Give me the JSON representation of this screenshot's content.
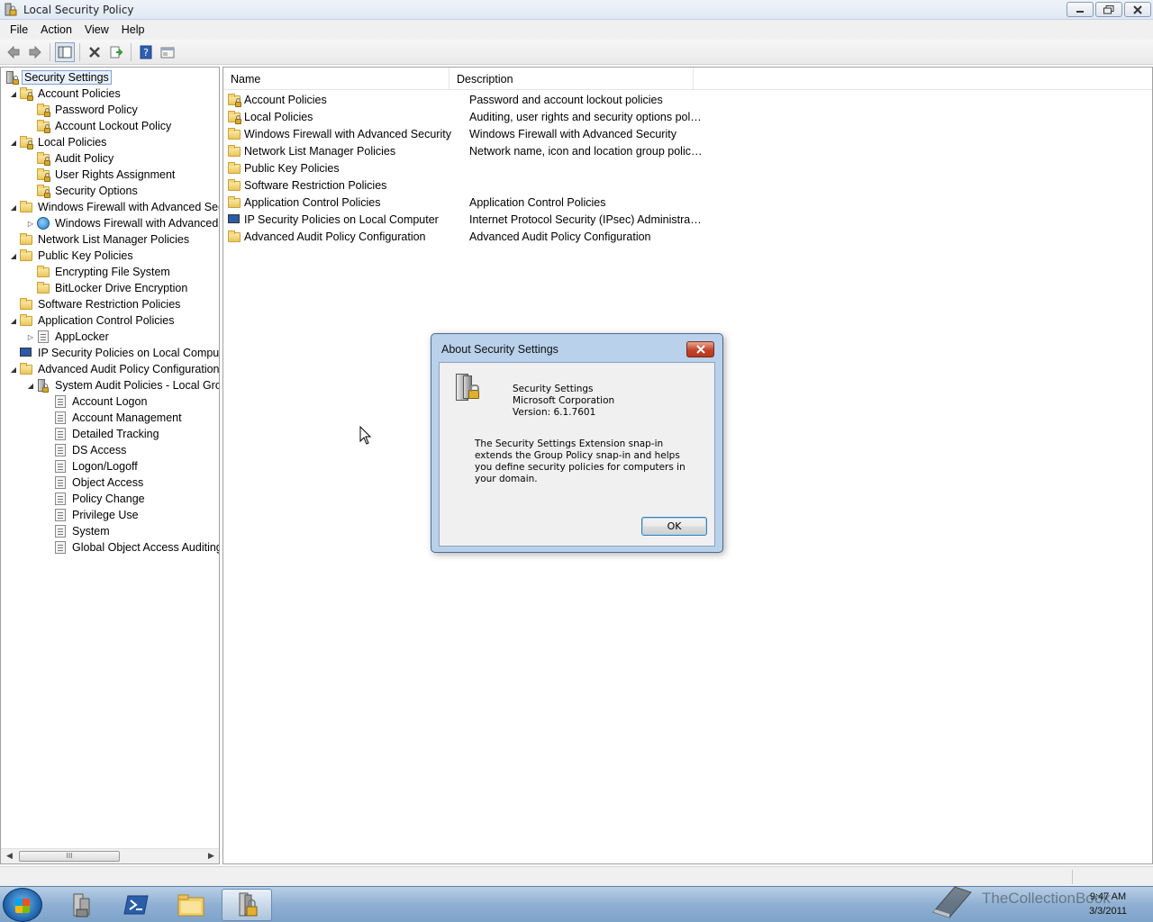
{
  "window": {
    "title": "Local Security Policy",
    "minimize_label": "▭",
    "restore_label": "❐",
    "close_label": "✕"
  },
  "menu": [
    "File",
    "Action",
    "View",
    "Help"
  ],
  "toolbar": {
    "buttons": [
      "back-icon",
      "forward-icon",
      "show-hide-tree-icon",
      "delete-icon",
      "export-list-icon",
      "help-icon",
      "properties-icon"
    ]
  },
  "tree": {
    "root": "Security Settings",
    "items": [
      {
        "label": "Account Policies",
        "icon": "folder-lock",
        "expanded": true
      },
      {
        "label": "Password Policy",
        "icon": "folder-lock"
      },
      {
        "label": "Account Lockout Policy",
        "icon": "folder-lock"
      },
      {
        "label": "Local Policies",
        "icon": "folder-lock",
        "expanded": true
      },
      {
        "label": "Audit Policy",
        "icon": "folder-lock"
      },
      {
        "label": "User Rights Assignment",
        "icon": "folder-lock"
      },
      {
        "label": "Security Options",
        "icon": "folder-lock"
      },
      {
        "label": "Windows Firewall with Advanced Secu",
        "icon": "folder",
        "expanded": true
      },
      {
        "label": "Windows Firewall with Advanced",
        "icon": "globe",
        "collapsed": true
      },
      {
        "label": "Network List Manager Policies",
        "icon": "folder"
      },
      {
        "label": "Public Key Policies",
        "icon": "folder",
        "expanded": true
      },
      {
        "label": "Encrypting File System",
        "icon": "folder"
      },
      {
        "label": "BitLocker Drive Encryption",
        "icon": "folder"
      },
      {
        "label": "Software Restriction Policies",
        "icon": "folder"
      },
      {
        "label": "Application Control Policies",
        "icon": "folder",
        "expanded": true
      },
      {
        "label": "AppLocker",
        "icon": "doc",
        "collapsed": true
      },
      {
        "label": "IP Security Policies on Local Compute",
        "icon": "monitor"
      },
      {
        "label": "Advanced Audit Policy Configuration",
        "icon": "folder",
        "expanded": true
      },
      {
        "label": "System Audit Policies - Local Grou",
        "icon": "server",
        "expanded": true
      },
      {
        "label": "Account Logon",
        "icon": "doc"
      },
      {
        "label": "Account Management",
        "icon": "doc"
      },
      {
        "label": "Detailed Tracking",
        "icon": "doc"
      },
      {
        "label": "DS Access",
        "icon": "doc"
      },
      {
        "label": "Logon/Logoff",
        "icon": "doc"
      },
      {
        "label": "Object Access",
        "icon": "doc"
      },
      {
        "label": "Policy Change",
        "icon": "doc"
      },
      {
        "label": "Privilege Use",
        "icon": "doc"
      },
      {
        "label": "System",
        "icon": "doc"
      },
      {
        "label": "Global Object Access Auditing",
        "icon": "doc"
      }
    ],
    "scroll_thumb_label": "III"
  },
  "list": {
    "columns": [
      "Name",
      "Description"
    ],
    "rows": [
      {
        "name": "Account Policies",
        "desc": "Password and account lockout policies",
        "icon": "folder-lock"
      },
      {
        "name": "Local Policies",
        "desc": "Auditing, user rights and security options polici...",
        "icon": "folder-lock"
      },
      {
        "name": "Windows Firewall with Advanced Security",
        "desc": "Windows Firewall with Advanced Security",
        "icon": "folder"
      },
      {
        "name": "Network List Manager Policies",
        "desc": "Network name, icon and location group policies.",
        "icon": "folder"
      },
      {
        "name": "Public Key Policies",
        "desc": "",
        "icon": "folder"
      },
      {
        "name": "Software Restriction Policies",
        "desc": "",
        "icon": "folder"
      },
      {
        "name": "Application Control Policies",
        "desc": "Application Control Policies",
        "icon": "folder"
      },
      {
        "name": "IP Security Policies on Local Computer",
        "desc": "Internet Protocol Security (IPsec) Administratio...",
        "icon": "monitor"
      },
      {
        "name": "Advanced Audit Policy Configuration",
        "desc": "Advanced Audit Policy Configuration",
        "icon": "folder"
      }
    ]
  },
  "dialog": {
    "title": "About Security Settings",
    "close_label": "✕",
    "product": "Security Settings",
    "company": "Microsoft Corporation",
    "version": "Version: 6.1.7601",
    "description": "The Security Settings Extension snap-in extends the Group Policy snap-in and helps you define security policies for computers in your domain.",
    "ok_label": "OK"
  },
  "taskbar": {
    "apps": [
      "server-manager-icon",
      "powershell-icon",
      "explorer-icon",
      "local-security-policy-icon"
    ],
    "watermark": "TheCollectionBook",
    "time": "9:47 AM",
    "date": "3/3/2011"
  }
}
